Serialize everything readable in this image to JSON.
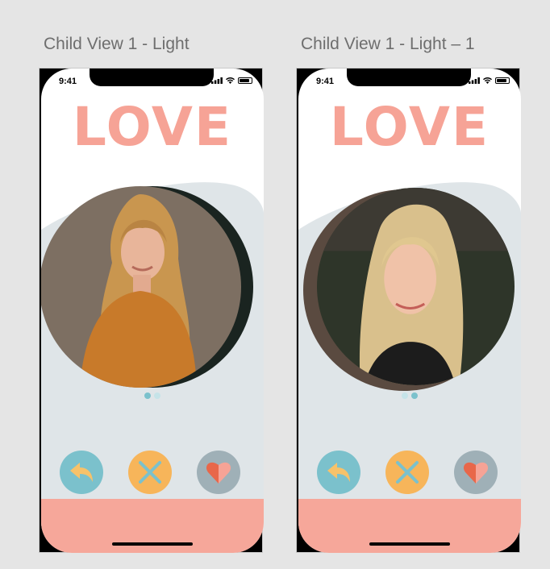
{
  "artboards": [
    {
      "label": "Child View 1 - Light",
      "status_time": "9:41",
      "logo": "LOVE",
      "active_dot": 0
    },
    {
      "label": "Child View 1 - Light – 1",
      "status_time": "9:41",
      "logo": "LOVE",
      "active_dot": 1
    }
  ],
  "actions": [
    {
      "name": "undo",
      "icon": "reply-arrow-icon",
      "bg": "#7bc1cc"
    },
    {
      "name": "dislike",
      "icon": "x-icon",
      "bg": "#f7b55a"
    },
    {
      "name": "like",
      "icon": "heart-icon",
      "bg": "#9fb0b7"
    }
  ],
  "colors": {
    "accent": "#f6a396",
    "footer": "#f6a79a",
    "card_blob": "#dfe5e8",
    "dot_active": "#7bc1cc",
    "dot_inactive": "#c5e3e8"
  }
}
